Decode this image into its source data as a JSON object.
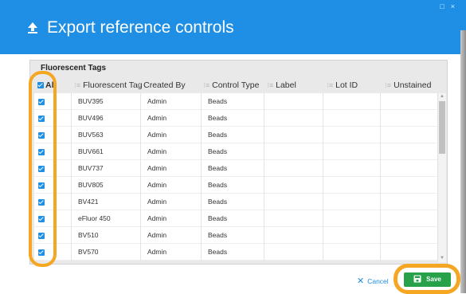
{
  "dialog": {
    "title": "Export reference controls",
    "window_controls": [
      "□",
      "×"
    ]
  },
  "panel": {
    "title": "Fluorescent Tags"
  },
  "table": {
    "select_all_label": "All",
    "columns": [
      "Fluorescent Tag",
      "Created By",
      "Control Type",
      "Label",
      "Lot ID",
      "Unstained"
    ],
    "rows": [
      {
        "checked": true,
        "tag": "BUV395",
        "created_by": "Admin",
        "control_type": "Beads",
        "label": "",
        "lot_id": "",
        "unstained": ""
      },
      {
        "checked": true,
        "tag": "BUV496",
        "created_by": "Admin",
        "control_type": "Beads",
        "label": "",
        "lot_id": "",
        "unstained": ""
      },
      {
        "checked": true,
        "tag": "BUV563",
        "created_by": "Admin",
        "control_type": "Beads",
        "label": "",
        "lot_id": "",
        "unstained": ""
      },
      {
        "checked": true,
        "tag": "BUV661",
        "created_by": "Admin",
        "control_type": "Beads",
        "label": "",
        "lot_id": "",
        "unstained": ""
      },
      {
        "checked": true,
        "tag": "BUV737",
        "created_by": "Admin",
        "control_type": "Beads",
        "label": "",
        "lot_id": "",
        "unstained": ""
      },
      {
        "checked": true,
        "tag": "BUV805",
        "created_by": "Admin",
        "control_type": "Beads",
        "label": "",
        "lot_id": "",
        "unstained": ""
      },
      {
        "checked": true,
        "tag": "BV421",
        "created_by": "Admin",
        "control_type": "Beads",
        "label": "",
        "lot_id": "",
        "unstained": ""
      },
      {
        "checked": true,
        "tag": "eFluor 450",
        "created_by": "Admin",
        "control_type": "Beads",
        "label": "",
        "lot_id": "",
        "unstained": ""
      },
      {
        "checked": true,
        "tag": "BV510",
        "created_by": "Admin",
        "control_type": "Beads",
        "label": "",
        "lot_id": "",
        "unstained": ""
      },
      {
        "checked": true,
        "tag": "BV570",
        "created_by": "Admin",
        "control_type": "Beads",
        "label": "",
        "lot_id": "",
        "unstained": ""
      }
    ]
  },
  "footer": {
    "cancel_label": "Cancel",
    "save_label": "Save"
  },
  "colors": {
    "header": "#1e8fe4",
    "save": "#27a24a",
    "highlight": "#f5a623",
    "cancel": "#1e8fe4"
  },
  "icons": [
    "export-icon",
    "checkbox-icon",
    "sort-icon",
    "close-icon",
    "save-icon"
  ]
}
